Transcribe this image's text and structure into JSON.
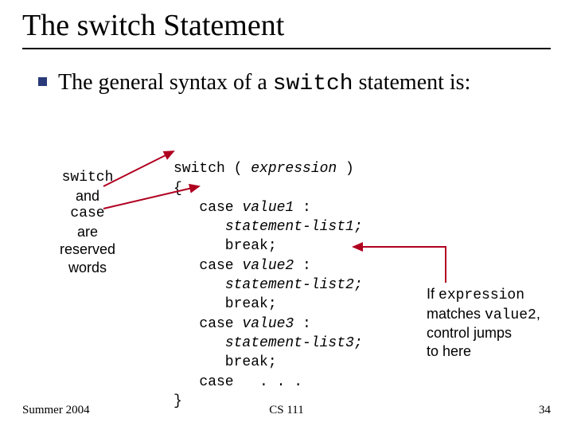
{
  "title": "The switch Statement",
  "bullet": {
    "pre": "The general syntax of a ",
    "code": "switch",
    "post": " statement is:"
  },
  "code": {
    "l1a": "switch ( ",
    "l1b": "expression",
    "l1c": " )",
    "l2": "{",
    "l3a": "   case ",
    "l3b": "value1",
    "l3c": " :",
    "l4a": "      ",
    "l4b": "statement-list1;",
    "l5": "      break;",
    "l6a": "   case ",
    "l6b": "value2",
    "l6c": " :",
    "l7a": "      ",
    "l7b": "statement-list2;",
    "l8": "      break;",
    "l9a": "   case ",
    "l9b": "value3",
    "l9c": " :",
    "l10a": "      ",
    "l10b": "statement-list3;",
    "l11": "      break;",
    "l12": "   case   . . .",
    "l13": "}"
  },
  "leftNote": {
    "l1": "switch",
    "l2": "and",
    "l3": "case",
    "l4": "are",
    "l5": "reserved",
    "l6": "words"
  },
  "rightNote": {
    "l1a": "If ",
    "l1b": "expression",
    "l2a": "matches ",
    "l2b": "value2",
    "l2c": ",",
    "l3": "control jumps",
    "l4": "to here"
  },
  "footer": {
    "left": "Summer 2004",
    "center": "CS 111",
    "right": "34"
  }
}
